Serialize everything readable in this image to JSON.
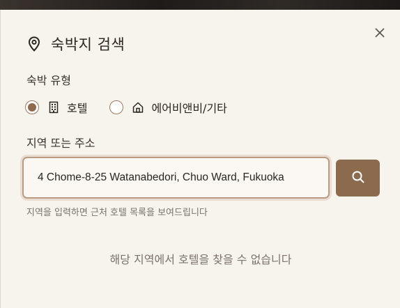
{
  "modal": {
    "title": "숙박지 검색",
    "close_icon": "close-icon",
    "accent": "#8b6a4e"
  },
  "lodging_type": {
    "label": "숙박 유형",
    "options": [
      {
        "label": "호텔",
        "icon": "building-icon",
        "selected": true
      },
      {
        "label": "에어비앤비/기타",
        "icon": "home-icon",
        "selected": false
      }
    ]
  },
  "region": {
    "label": "지역 또는 주소",
    "input_value": "4 Chome-8-25 Watanabedori, Chuo Ward, Fukuoka",
    "search_icon": "search-icon",
    "hint": "지역을 입력하면 근처 호텔 목록을 보여드립니다"
  },
  "results": {
    "empty_message": "해당 지역에서 호텔을 찾을 수 없습니다"
  }
}
